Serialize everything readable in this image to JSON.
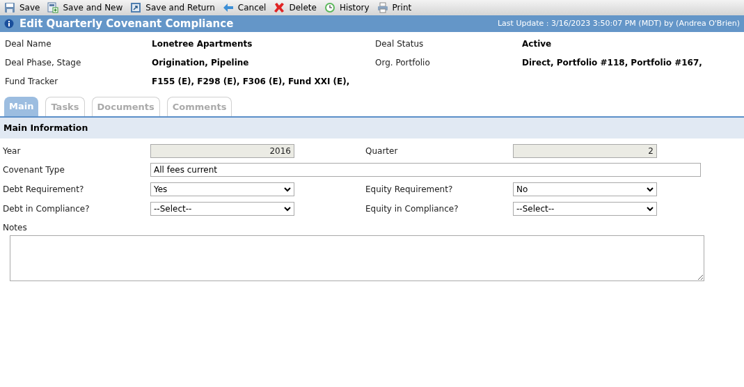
{
  "toolbar": [
    {
      "kind": "save",
      "label": "Save"
    },
    {
      "kind": "save_new",
      "label": "Save and New"
    },
    {
      "kind": "save_return",
      "label": "Save and Return"
    },
    {
      "kind": "cancel",
      "label": "Cancel"
    },
    {
      "kind": "delete",
      "label": "Delete"
    },
    {
      "kind": "history",
      "label": "History"
    },
    {
      "kind": "print",
      "label": "Print"
    }
  ],
  "title_bar": {
    "title": "Edit Quarterly Covenant Compliance",
    "last_update": "Last Update : 3/16/2023 3:50:07 PM (MDT) by (Andrea O'Brien)"
  },
  "deal_info": [
    [
      {
        "label": "Deal Name",
        "value": "Lonetree Apartments"
      },
      {
        "label": "Deal Status",
        "value": "Active"
      }
    ],
    [
      {
        "label": "Deal Phase, Stage",
        "value": "Origination, Pipeline"
      },
      {
        "label": "Org. Portfolio",
        "value": "Direct, Portfolio #118, Portfolio #167,"
      }
    ],
    [
      {
        "label": "Fund Tracker",
        "value": "F155 (E), F298 (E), F306 (E), Fund XXI (E),"
      }
    ]
  ],
  "tabs": [
    {
      "label": "Main",
      "selected": true
    },
    {
      "label": "Tasks",
      "selected": false
    },
    {
      "label": "Documents",
      "selected": false
    },
    {
      "label": "Comments",
      "selected": false
    }
  ],
  "section": {
    "title": "Main Information"
  },
  "form_rows": [
    [
      {
        "kind": "readonly",
        "label": "Year",
        "value": "2016"
      },
      {
        "kind": "readonly",
        "label": "Quarter",
        "value": "2"
      }
    ],
    [
      {
        "kind": "wide",
        "label": "Covenant Type",
        "value": "All fees current"
      }
    ],
    [
      {
        "kind": "select",
        "label": "Debt Requirement?",
        "value": "Yes"
      },
      {
        "kind": "select",
        "label": "Equity Requirement?",
        "value": "No"
      }
    ],
    [
      {
        "kind": "select",
        "label": "Debt in Compliance?",
        "value": "--Select--"
      },
      {
        "kind": "select",
        "label": "Equity in Compliance?",
        "value": "--Select--"
      }
    ]
  ],
  "notes": {
    "label": "Notes"
  }
}
